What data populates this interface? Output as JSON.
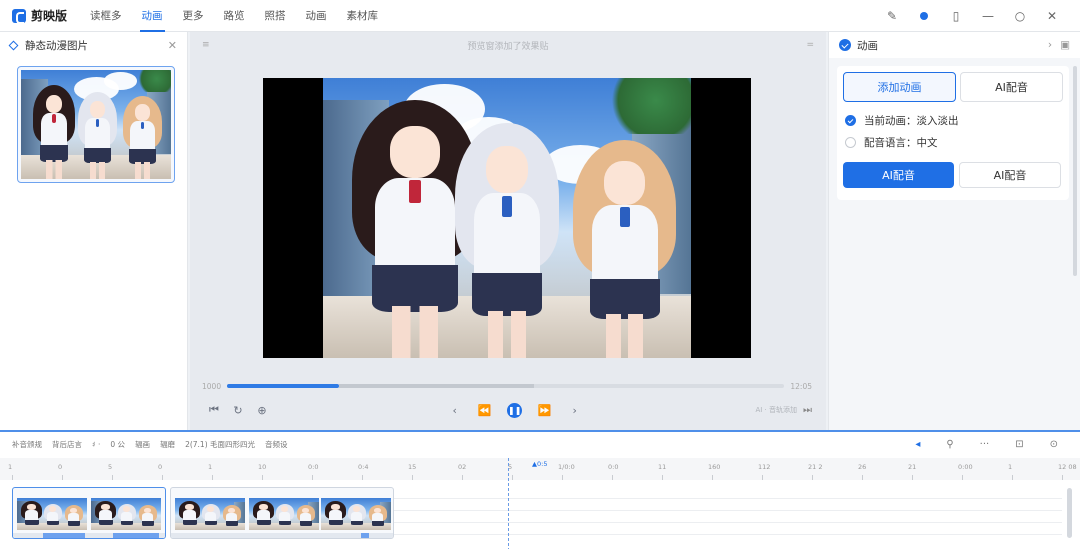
{
  "app": {
    "name": "剪映版"
  },
  "menu": [
    {
      "label": "读框多",
      "active": false
    },
    {
      "label": "动画",
      "active": true
    },
    {
      "label": "更多",
      "active": false
    },
    {
      "label": "路览",
      "active": false
    },
    {
      "label": "照搭",
      "active": false
    },
    {
      "label": "动画",
      "active": false
    },
    {
      "label": "素材库",
      "active": false
    }
  ],
  "left_panel": {
    "title": "静态动漫图片"
  },
  "preview": {
    "hint": "预览窗添加了效果贴",
    "time_start": "1000",
    "time_end": "12:05",
    "progress_fraction": 0.2,
    "buffer_fraction": 0.55,
    "right_hint": "AI · 音轨添加"
  },
  "right_panel": {
    "title": "动画",
    "tabs": [
      "添加动画",
      "AI配音"
    ],
    "options": [
      {
        "label": "当前动画：淡入淡出",
        "checked": true
      },
      {
        "label": "配音语言：中文",
        "checked": false
      }
    ],
    "action_primary": "AI配音",
    "action_secondary": "AI配音"
  },
  "timeline": {
    "toolbar": [
      "补音颁规",
      "背后店言",
      "♯ ·",
      "0 公",
      "辐画",
      "辐磨",
      "2(7.1) 毛面四形四光",
      "音频设"
    ],
    "ruler": [
      "1",
      "0",
      "5",
      "0",
      "1",
      "10",
      "0:0",
      "0:4",
      "15",
      "02",
      "5",
      "1/0:0",
      "0:0",
      "11",
      "160",
      "112",
      "21 2",
      "26",
      "21",
      "0:00",
      "1",
      "12 08"
    ],
    "playhead_label": "▲0:5"
  },
  "colors": {
    "accent": "#1f6fe5",
    "timeline_border": "#4f8fe9"
  }
}
